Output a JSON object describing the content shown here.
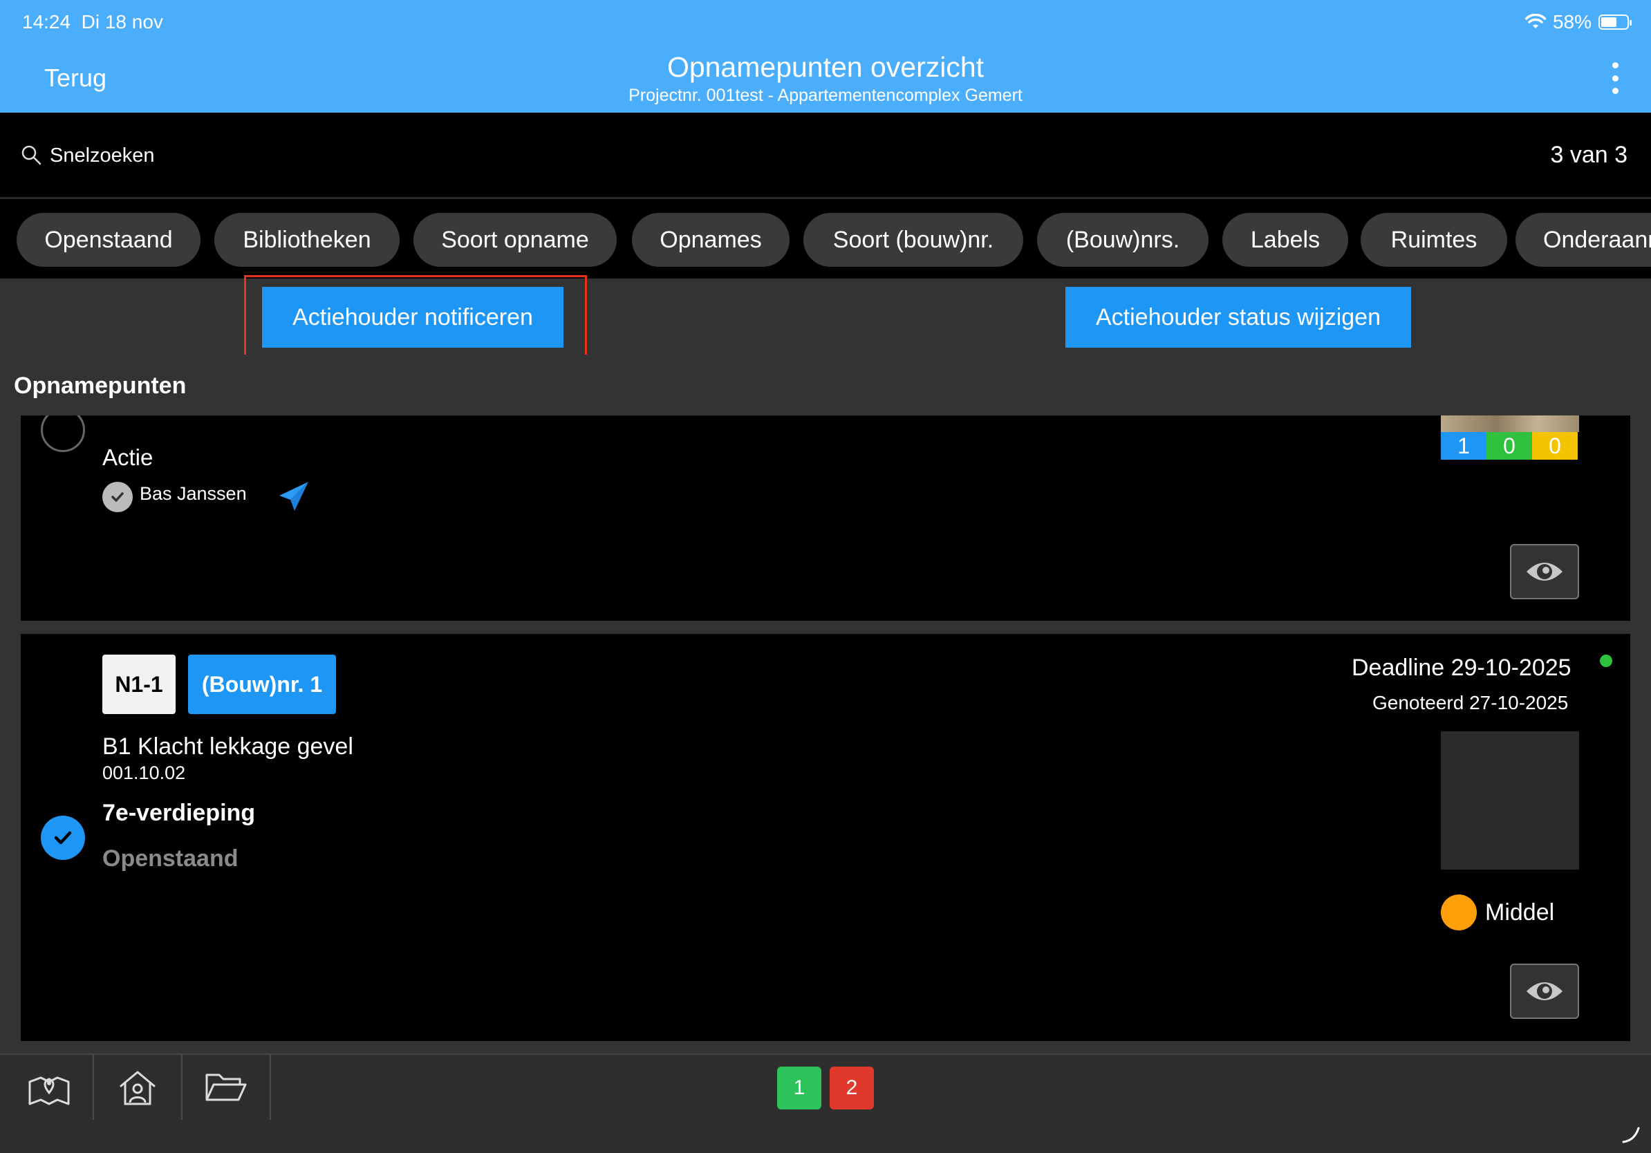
{
  "status": {
    "time": "14:24",
    "date": "Di 18 nov",
    "battery": "58%"
  },
  "header": {
    "back_label": "Terug",
    "title": "Opnamepunten overzicht",
    "subtitle": "Projectnr. 001test - Appartementencomplex Gemert"
  },
  "search": {
    "placeholder": "Snelzoeken",
    "count": "3 van 3"
  },
  "filters": [
    "Openstaand",
    "Bibliotheken",
    "Soort opname",
    "Opnames",
    "Soort (bouw)nr.",
    "(Bouw)nrs.",
    "Labels",
    "Ruimtes",
    "Onderaann"
  ],
  "actions": {
    "notify": "Actiehouder notificeren",
    "status": "Actiehouder status wijzigen"
  },
  "section_title": "Opnamepunten",
  "items": [
    {
      "selected": false,
      "type_label": "Actie",
      "assignee": "Bas  Janssen",
      "counts": [
        "1",
        "0",
        "0"
      ]
    },
    {
      "selected": true,
      "code": "N1-1",
      "building_tag": "(Bouw)nr. 1",
      "title": "B1 Klacht lekkage gevel",
      "number": "001.10.02",
      "location": "7e-verdieping",
      "status": "Openstaand",
      "deadline": "Deadline 29-10-2025",
      "noted": "Genoteerd 27-10-2025",
      "priority": "Middel"
    }
  ],
  "pagination": [
    "1",
    "2"
  ],
  "colors": {
    "header": "#4aaefc",
    "accent": "#1e96f5",
    "count_blue": "#1e96f5",
    "count_green": "#2ec23f",
    "count_yellow": "#f5c400",
    "priority_orange": "#ff9f0a",
    "status_dot": "#2ec23f",
    "page1": "#2ec25a",
    "page2": "#e0382b"
  },
  "icons": [
    "search-icon",
    "more-icon",
    "wifi-icon",
    "battery-icon",
    "send-icon",
    "eye-icon",
    "map-icon",
    "home-user-icon",
    "folder-icon",
    "checkmark-icon"
  ]
}
